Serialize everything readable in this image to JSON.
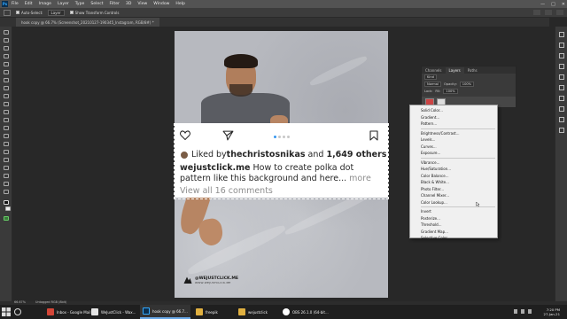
{
  "app": {
    "menu_items": [
      "File",
      "Edit",
      "Image",
      "Layer",
      "Type",
      "Select",
      "Filter",
      "3D",
      "View",
      "Window",
      "Help"
    ],
    "window_controls": [
      "—",
      "□",
      "✕"
    ]
  },
  "options_bar": {
    "auto_select_label": "Auto-Select:",
    "auto_select_value": "Layer",
    "transform_label": "Show Transform Controls"
  },
  "document_tab": {
    "title": "hook copy @ 66.7% (Screenshot_20210127-190345_Instagram, RGB/8#) *"
  },
  "instagram": {
    "liked_prefix": "Liked by ",
    "liked_user": "thechristosnikas",
    "liked_and": " and ",
    "liked_count": "1,649 others",
    "caption_user": "wejustclick.me",
    "caption_text": " How to create polka dot pattern like this background and here...",
    "more": " more",
    "view_comments": "View all 16 comments"
  },
  "logo": {
    "name": "@WEJUSTCLICK.ME",
    "tagline": "WWW.WEJUSTCLICK.ME"
  },
  "layers_panel": {
    "tabs": [
      "Channels",
      "Layers",
      "Paths"
    ],
    "kind": "Kind",
    "blend_mode": "Normal",
    "opacity_label": "Opacity:",
    "opacity": "100%",
    "lock_label": "Lock:",
    "fill_label": "Fill:",
    "fill": "100%"
  },
  "context_menu": {
    "group1": [
      "Solid Color...",
      "Gradient...",
      "Pattern..."
    ],
    "group2": [
      "Brightness/Contrast...",
      "Levels...",
      "Curves...",
      "Exposure..."
    ],
    "group3": [
      "Vibrance...",
      "Hue/Saturation...",
      "Color Balance...",
      "Black & White...",
      "Photo Filter...",
      "Channel Mixer...",
      "Color Lookup..."
    ],
    "group4": [
      "Invert",
      "Posterize...",
      "Threshold...",
      "Gradient Map...",
      "Selective Color..."
    ]
  },
  "status_bar": {
    "zoom": "66.67%",
    "profile": "Untagged RGB (8bit)"
  },
  "taskbar": {
    "items": [
      {
        "label": "Inbox - Google Mail",
        "color": "#d44638"
      },
      {
        "label": "WeJustClick - Wax...",
        "color": "#e5e5e5"
      },
      {
        "label": "hook copy @ 66.7...",
        "color": "#31a8ff"
      },
      {
        "label": "freepik",
        "color": "#e0b040"
      },
      {
        "label": "wejustclick",
        "color": "#e0b040"
      },
      {
        "label": "OBS 26.1.0 (64-bit...",
        "color": "#ffffff"
      }
    ],
    "time": "7:20 PM",
    "date": "27-Jan-21"
  },
  "colors": {
    "instagram_dot_active": "#3897f0",
    "photoshop_blue": "#31a8ff"
  }
}
